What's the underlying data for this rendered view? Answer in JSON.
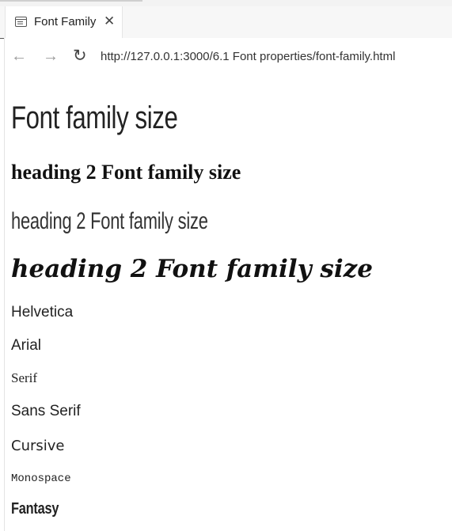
{
  "browser": {
    "tab": {
      "title": "Font Family",
      "icon": "page-icon",
      "close_glyph": "✕"
    },
    "nav": {
      "back_glyph": "←",
      "forward_glyph": "→",
      "reload_glyph": "↻"
    },
    "address": "http://127.0.0.1:3000/6.1 Font properties/font-family.html"
  },
  "page": {
    "h1": "Font family size",
    "h2_serif_bold": "heading 2 Font family size",
    "h2_light_sans": "heading 2 Font family size",
    "h2_serif_bold_italic": "heading 2 Font family size",
    "paragraphs": [
      "Helvetica",
      "Arial",
      "Serif",
      "Sans Serif",
      "Cursive",
      "Monospace",
      "Fantasy"
    ]
  }
}
